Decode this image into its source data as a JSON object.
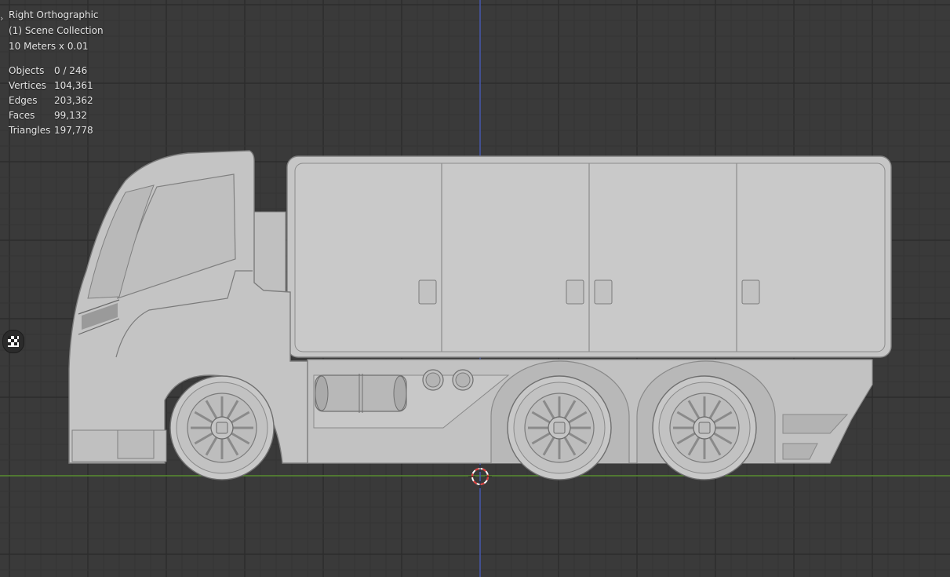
{
  "viewport": {
    "view_name": "Right Orthographic",
    "collection": "(1) Scene Collection",
    "grid_scale": "10 Meters x 0.01"
  },
  "stats": [
    {
      "label": "Objects",
      "value": "0 / 246"
    },
    {
      "label": "Vertices",
      "value": "104,361"
    },
    {
      "label": "Edges",
      "value": "203,362"
    },
    {
      "label": "Faces",
      "value": "99,132"
    },
    {
      "label": "Triangles",
      "value": "197,778"
    }
  ],
  "colors": {
    "background": "#3a3a3a",
    "grid_minor": "#343434",
    "grid_major": "#2c2c2c",
    "axis_x": "#5a8f32",
    "axis_z": "#4a5db8",
    "model_fill": "#c6c6c6",
    "model_shade": "#9e9e9e",
    "model_line": "#707070",
    "cursor_red": "#e03a3a"
  },
  "icons": {
    "collapse": "chevron-right-icon",
    "side_toggle": "checker-icon",
    "cursor": "3d-cursor-icon"
  }
}
